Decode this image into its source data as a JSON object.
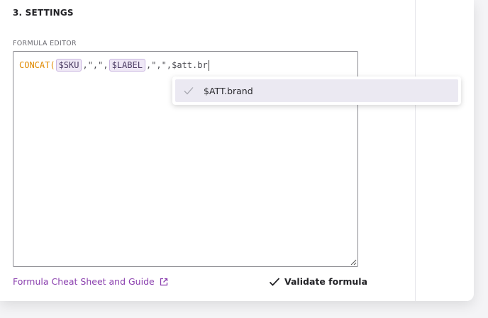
{
  "section": {
    "title": "3. SETTINGS"
  },
  "editor": {
    "label": "FORMULA EDITOR",
    "tokens": {
      "fn": "CONCAT(",
      "var1": "$SKU",
      "sep1": ",\",\",",
      "var2": "$LABEL",
      "sep2": ",\",\",",
      "typing": "$att.br"
    }
  },
  "autocomplete": {
    "items": [
      {
        "label": "$ATT.brand"
      }
    ]
  },
  "footer": {
    "guide_link": "Formula Cheat Sheet and Guide",
    "validate_label": "Validate formula"
  },
  "colors": {
    "function": "#e08a00",
    "variable_bg": "#efe8f6",
    "link": "#8a3fae"
  },
  "icons": {
    "suggestion": "check-icon",
    "guide": "external-link-icon",
    "validate": "check-icon"
  }
}
